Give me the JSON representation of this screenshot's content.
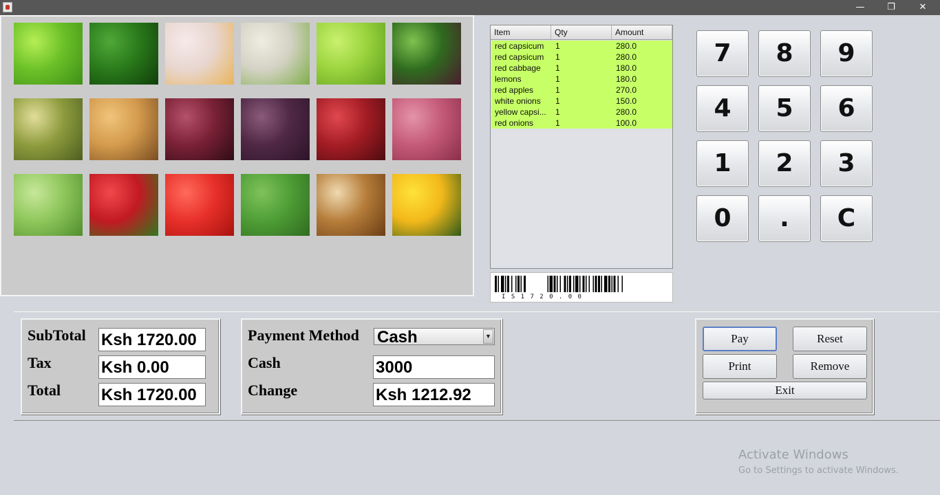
{
  "window": {
    "minimize_glyph": "—",
    "restore_glyph": "❐",
    "close_glyph": "✕"
  },
  "products": [
    {
      "name": "lime-icon",
      "colors": [
        "#b6ee55",
        "#6cc128",
        "#3e8f17"
      ]
    },
    {
      "name": "green-pepper-icon",
      "colors": [
        "#4fa838",
        "#2a7a1b",
        "#103d0a"
      ]
    },
    {
      "name": "lemon-icon",
      "colors": [
        "#f6eaea",
        "#e8d6cf",
        "#e9b45a"
      ]
    },
    {
      "name": "white-onion-icon",
      "colors": [
        "#efece2",
        "#d4d2c4",
        "#7fae4b"
      ]
    },
    {
      "name": "lemons-green-icon",
      "colors": [
        "#c9f06e",
        "#9bd43e",
        "#5e9f1f"
      ]
    },
    {
      "name": "lettuce-icon",
      "colors": [
        "#7ec24f",
        "#2f6b1f",
        "#4a1d2e"
      ]
    },
    {
      "name": "pineapple-icon",
      "colors": [
        "#e2dd9a",
        "#8e9c3e",
        "#4d5e1f"
      ]
    },
    {
      "name": "potato-icon",
      "colors": [
        "#f0c47a",
        "#d39a4c",
        "#7a4d22"
      ]
    },
    {
      "name": "red-apple-icon",
      "colors": [
        "#b5506a",
        "#7a2136",
        "#2e0c15"
      ]
    },
    {
      "name": "red-cabbage-icon",
      "colors": [
        "#8a5a7a",
        "#4f2846",
        "#2c1428"
      ]
    },
    {
      "name": "red-apples-icon",
      "colors": [
        "#e0484e",
        "#a41c24",
        "#4d0c10"
      ]
    },
    {
      "name": "red-onion-icon",
      "colors": [
        "#e493a8",
        "#c45a78",
        "#8a2e4a"
      ]
    },
    {
      "name": "celery-icon",
      "colors": [
        "#c7e79a",
        "#8fc75c",
        "#4f8e2d"
      ]
    },
    {
      "name": "strawberry-icon",
      "colors": [
        "#f0484a",
        "#c21a22",
        "#2f7a1f"
      ]
    },
    {
      "name": "tomato-icon",
      "colors": [
        "#ff6a5a",
        "#e8302a",
        "#a8120e"
      ]
    },
    {
      "name": "cabbage-leaf-icon",
      "colors": [
        "#7fc25a",
        "#4f9e36",
        "#2f6b1f"
      ]
    },
    {
      "name": "onion-icon",
      "colors": [
        "#efd9b0",
        "#b67d3a",
        "#6b3d14"
      ]
    },
    {
      "name": "yellow-pepper-icon",
      "colors": [
        "#ffe23a",
        "#f2b81a",
        "#2f5a1a"
      ]
    }
  ],
  "table": {
    "headers": [
      "Item",
      "Qty",
      "Amount"
    ],
    "rows": [
      [
        "red capsicum",
        "1",
        "280.0"
      ],
      [
        "red capsicum",
        "1",
        "280.0"
      ],
      [
        "red cabbage",
        "1",
        "180.0"
      ],
      [
        "lemons",
        "1",
        "180.0"
      ],
      [
        "red apples",
        "1",
        "270.0"
      ],
      [
        "white onions",
        "1",
        "150.0"
      ],
      [
        "yellow capsi...",
        "1",
        "280.0"
      ],
      [
        "red onions",
        "1",
        "100.0"
      ]
    ]
  },
  "barcode": {
    "text": "IS1720.00"
  },
  "keypad": [
    "7",
    "8",
    "9",
    "4",
    "5",
    "6",
    "1",
    "2",
    "3",
    "0",
    ".",
    "C"
  ],
  "totals": {
    "subtotal_label": "SubTotal",
    "subtotal_value": "Ksh 1720.00",
    "tax_label": "Tax",
    "tax_value": "Ksh 0.00",
    "total_label": "Total",
    "total_value": "Ksh 1720.00"
  },
  "payment": {
    "method_label": "Payment Method",
    "method_value": "Cash",
    "cash_label": "Cash",
    "cash_value": "3000",
    "change_label": "Change",
    "change_value": "Ksh 1212.92"
  },
  "actions": {
    "pay": "Pay",
    "reset": "Reset",
    "print": "Print",
    "remove": "Remove",
    "exit": "Exit"
  },
  "watermark": {
    "line1": "Activate Windows",
    "line2": "Go to Settings to activate Windows."
  }
}
